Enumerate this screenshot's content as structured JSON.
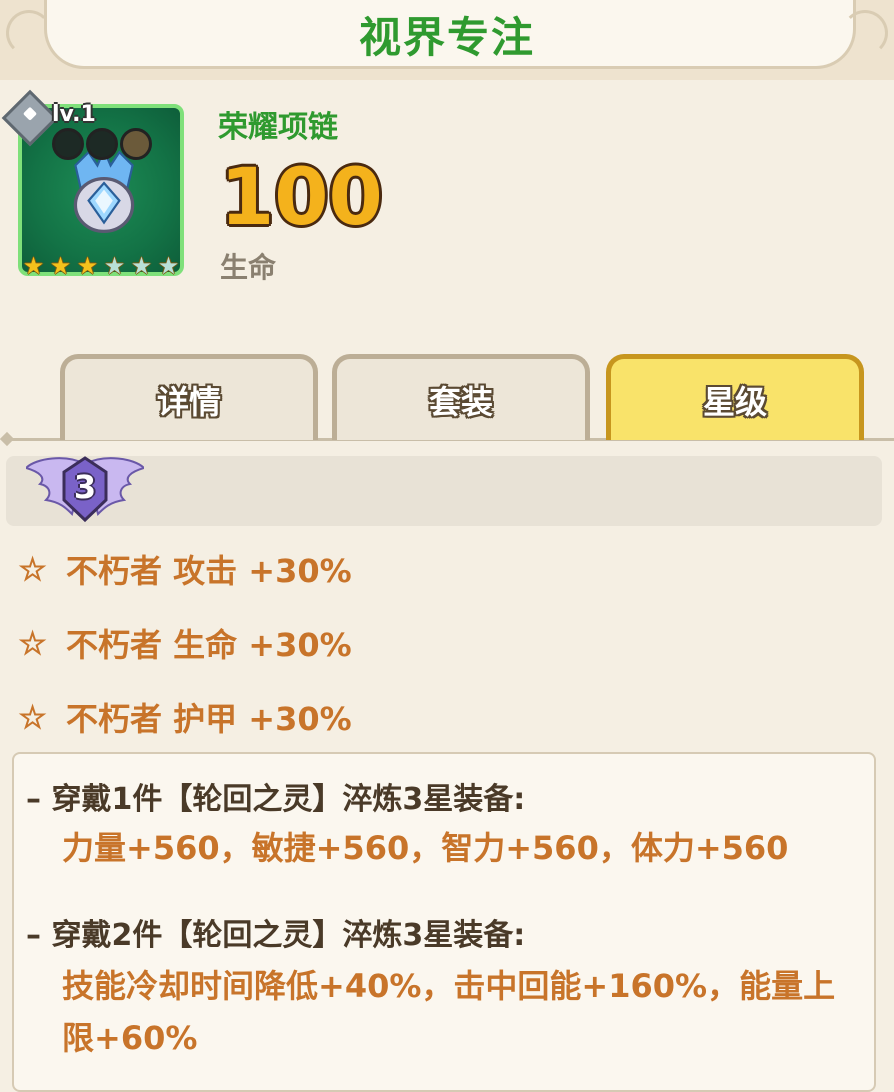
{
  "header": {
    "title": "视界专注"
  },
  "item": {
    "level": "lv.1",
    "name": "荣耀项链",
    "value": "100",
    "stat": "生命",
    "stars_filled": 3,
    "stars_total": 6,
    "colors": {
      "frame": "#7fe07a",
      "background": "#137346",
      "name": "#2f9a2f",
      "value": "#f4b21c"
    }
  },
  "tabs": [
    {
      "label": "详情",
      "active": false
    },
    {
      "label": "套装",
      "active": false
    },
    {
      "label": "星级",
      "active": true
    }
  ],
  "star_level": {
    "number": "3"
  },
  "bonuses": [
    {
      "icon": "star-outline-icon",
      "text": "不朽者 攻击 +30%"
    },
    {
      "icon": "star-outline-icon",
      "text": "不朽者 生命 +30%"
    },
    {
      "icon": "star-outline-icon",
      "text": "不朽者 护甲 +30%"
    }
  ],
  "set_bonuses": [
    {
      "title": "– 穿戴1件【轮回之灵】淬炼3星装备:",
      "desc": "力量+560，敏捷+560，智力+560，体力+560"
    },
    {
      "title": "– 穿戴2件【轮回之灵】淬炼3星装备:",
      "desc": "技能冷却时间降低+40%，击中回能+160%，能量上限+60%"
    }
  ]
}
